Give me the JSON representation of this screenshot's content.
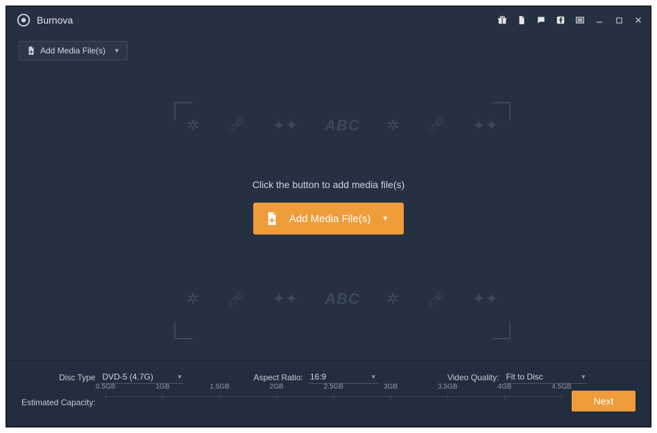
{
  "header": {
    "app_name": "Burnova",
    "window_icons": {
      "gift": "gift-icon",
      "doc": "document-icon",
      "chat": "chat-icon",
      "fb": "facebook-icon",
      "menu": "menu-icon",
      "min": "minimize-icon",
      "max": "maximize-icon",
      "close": "close-icon"
    }
  },
  "toolbar": {
    "add_media_label": "Add Media File(s)"
  },
  "canvas": {
    "prompt": "Click the button to add media file(s)",
    "add_media_label": "Add Media File(s)",
    "ghost_text": "ABC"
  },
  "footer": {
    "disc_type_label": "Disc Type",
    "disc_type_value": "DVD-5 (4.7G)",
    "aspect_label": "Aspect Ratio:",
    "aspect_value": "16:9",
    "quality_label": "Video Quality:",
    "quality_value": "Fit to Disc",
    "capacity_label": "Estimated Capacity:",
    "ticks": [
      "0.5GB",
      "1GB",
      "1.5GB",
      "2GB",
      "2.5GB",
      "3GB",
      "3.5GB",
      "4GB",
      "4.5GB"
    ],
    "next_label": "Next"
  },
  "colors": {
    "accent": "#ef9c3a",
    "bg": "#253041"
  }
}
